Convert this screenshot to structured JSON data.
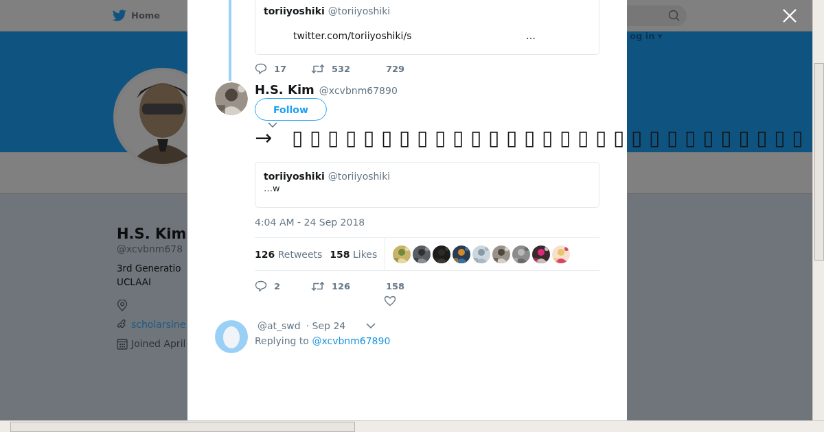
{
  "nav": {
    "home": "Home",
    "login": "og in ▾"
  },
  "profile": {
    "name": "H.S. Kim",
    "handle": "@xcvbnm678",
    "bio": [
      "3rd Generatio",
      "UCLAAI"
    ],
    "link": "scholarsine",
    "joined": "Joined April"
  },
  "thread": {
    "quote": {
      "name": "toriiyoshiki",
      "handle": "@toriiyoshiki",
      "link": "twitter.com/toriiyoshiki/s",
      "ellipsis": "…"
    },
    "actions": {
      "replies": "17",
      "retweets": "532",
      "likes": "729"
    }
  },
  "tweet": {
    "name": "H.S. Kim",
    "handle": "@xcvbnm67890",
    "follow": "Follow",
    "text": "→ ▯▯▯▯▯▯▯▯▯▯▯▯▯▯▯▯▯▯▯▯▯▯▯▯▯▯▯▯▯",
    "quote": {
      "name": "toriiyoshiki",
      "handle": "@toriiyoshiki",
      "text": "…w"
    },
    "time": "4:04 AM - 24 Sep 2018",
    "retweets": "**126** Retweets",
    "likes": "**158** Likes",
    "actions": {
      "replies": "2",
      "retweets": "126",
      "likes": "158"
    }
  },
  "reply": {
    "handle": "@at_swd",
    "date": "· Sep 24",
    "replying_label": "Replying to",
    "replying_to": "@xcvbnm67890"
  }
}
